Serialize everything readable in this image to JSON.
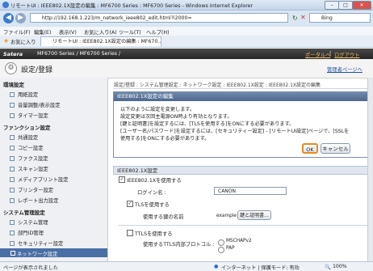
{
  "window": {
    "title": "リモートUI : IEEE802.1X設定の編集 : MF6700 Series : MF6700 Series - Windows Internet Explorer",
    "min": "–",
    "max": "□",
    "close": "✕"
  },
  "address": {
    "url": "http://192.168.1.223/m_network_ieee802_edit.html?i2000=",
    "search_placeholder": "Bing"
  },
  "menu": [
    "ファイル(F)",
    "編集(E)",
    "表示(V)",
    "お気に入り(A)",
    "ツール(T)",
    "ヘルプ(H)"
  ],
  "favorites": {
    "label": "お気に入り",
    "tab": "リモートUI : IEEE802.1X設定の編集 : MF670..."
  },
  "header": {
    "brand": "Satera",
    "model": "MF6700 Series / MF6700 Series /",
    "portal": "ポータルへ",
    "logout": "ログアウト"
  },
  "page": {
    "title": "設定/登録",
    "manager_link": "管理者ページへ"
  },
  "sidebar": {
    "env_head": "環境設定",
    "env_items": [
      "用紙設定",
      "音量調整/表示設定",
      "タイマー設定"
    ],
    "func_head": "ファンクション設定",
    "func_items": [
      "共通設定",
      "コピー設定",
      "ファクス設定",
      "スキャン設定",
      "メディアプリント設定",
      "プリンター設定",
      "レポート出力設定"
    ],
    "sys_head": "システム管理設定",
    "sys_items": [
      "システム管理",
      "部門ID管理",
      "セキュリティー設定",
      "ネットワーク設定"
    ]
  },
  "breadcrumb": "設定/登録 : システム管理設定 : ネットワーク設定 : IEEE802.1X設定 : IEEE802.1X設定の編集",
  "dialog": {
    "title": "IEEE802.1X設定の編集",
    "lines": [
      "以下のように設定を変更します。",
      "設定変更は次回主電源ON時より有効となります。",
      "[鍵と証明書]を設定するには、[TLSを使用する]をONにする必要があります。",
      "[ユーザー名/パスワード]を設定するには、[セキュリティー設定] - [リモートUI設定]ページで、[SSLを",
      "使用する]をONにする必要があります。"
    ],
    "ok": "OK",
    "cancel": "キャンセル"
  },
  "form": {
    "section": "IEEE802.1X設定",
    "use_ieee": "IEEE802.1Xを使用する",
    "login_label": "ログイン名 :",
    "login_value": "CANON",
    "use_tls": "TLSを使用する",
    "key_label": "使用する鍵の名前",
    "key_value": "example",
    "key_button": "鍵と証明書...",
    "use_ttls": "TTLSを使用する",
    "ttls_proto_label": "使用するTTLS内部プロトコル :",
    "proto_options": [
      "MSCHAPv2",
      "PAP"
    ]
  },
  "status": {
    "left": "ページが表示されました",
    "zone": "インターネット | 保護モード: 有効",
    "zoom": "100%"
  }
}
